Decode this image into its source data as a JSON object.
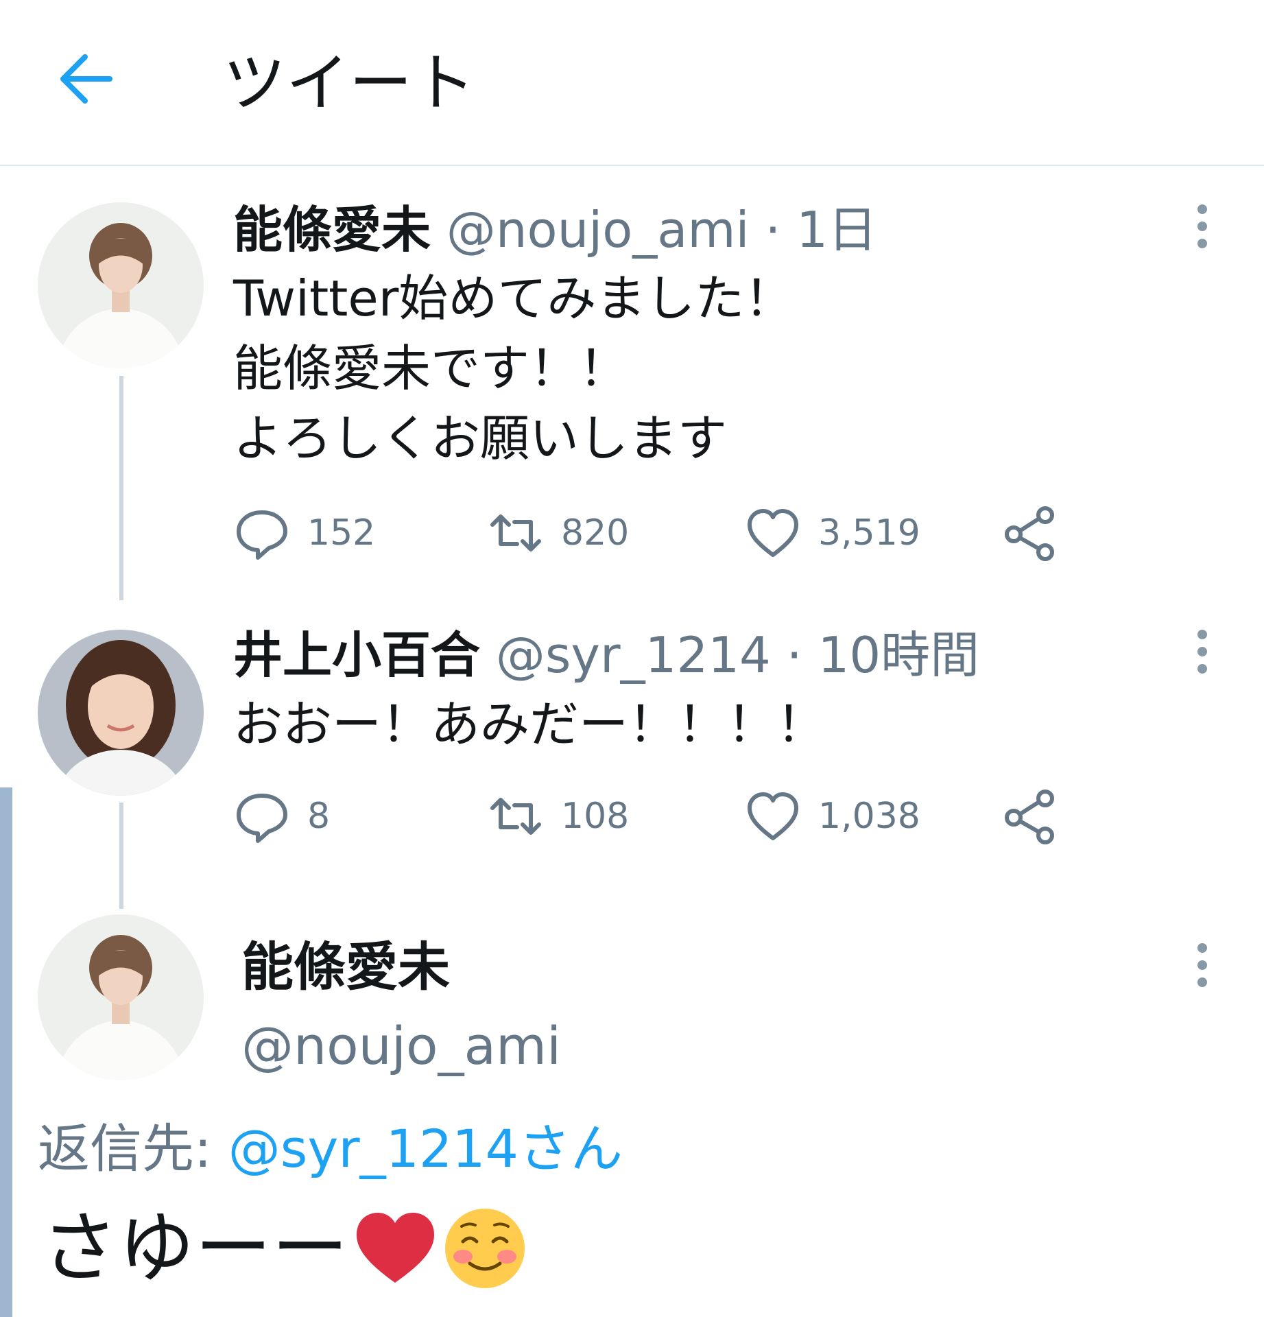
{
  "header": {
    "title": "ツイート"
  },
  "tweets": [
    {
      "name": "能條愛未",
      "handle": "@noujo_ami",
      "dot": "·",
      "time": "1日",
      "lines": [
        "Twitter始めてみました！",
        "能條愛未です！！",
        "よろしくお願いします"
      ],
      "replies": "152",
      "retweets": "820",
      "likes": "3,519"
    },
    {
      "name": "井上小百合",
      "handle": "@syr_1214",
      "dot": "·",
      "time": "10時間",
      "lines": [
        "おおー！あみだー！！！！"
      ],
      "replies": "8",
      "retweets": "108",
      "likes": "1,038"
    }
  ],
  "focus": {
    "name": "能條愛未",
    "handle": "@noujo_ami",
    "reply_label": "返信先:",
    "reply_target": "@syr_1214さん",
    "text": "さゆーー"
  },
  "colors": {
    "accent": "#1da1f2",
    "muted": "#657786",
    "divider": "#e1e8ed"
  },
  "icons": [
    "back-arrow-icon",
    "more-icon",
    "reply-icon",
    "retweet-icon",
    "like-icon",
    "share-icon",
    "heart-emoji",
    "smiling-emoji"
  ]
}
